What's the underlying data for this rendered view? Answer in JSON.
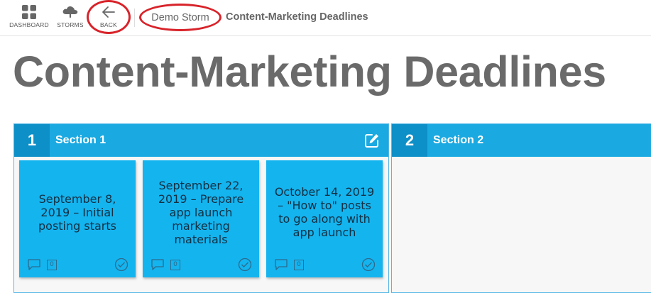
{
  "nav": {
    "dashboard_label": "DASHBOARD",
    "storms_label": "STORMS",
    "back_label": "BACK"
  },
  "breadcrumb": {
    "storm_name": "Demo Storm",
    "current": "Content-Marketing Deadlines"
  },
  "page_title": "Content-Marketing Deadlines",
  "sections": [
    {
      "number": "1",
      "name": "Section 1",
      "notes": [
        {
          "text": "September 8, 2019 – Initial posting starts",
          "comments": "0"
        },
        {
          "text": "September 22, 2019 – Prepare app launch marketing materials",
          "comments": "0"
        },
        {
          "text": "October 14, 2019 – \"How to\" posts to go along with app launch",
          "comments": "0"
        }
      ]
    },
    {
      "number": "2",
      "name": "Section 2",
      "notes": []
    }
  ],
  "colors": {
    "section_header": "#1aa9e1",
    "section_number_bg": "#0d8fc7",
    "note_bg": "#14b4ef",
    "highlight_circle": "#d8232a"
  },
  "icons": {
    "dashboard": "grid-icon",
    "storms": "cloud-upload-icon",
    "back": "arrow-left-icon",
    "edit": "edit-icon",
    "comment": "comment-icon",
    "done": "check-circle-icon"
  }
}
